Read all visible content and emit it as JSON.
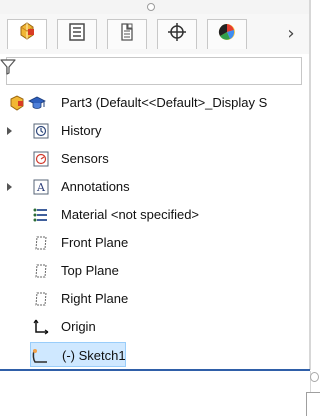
{
  "panel": {
    "tabs": [
      {
        "name": "featuremanager-tab",
        "icon": "featuremanager-icon"
      },
      {
        "name": "propertymanager-tab",
        "icon": "propertymanager-icon"
      },
      {
        "name": "configurationmanager-tab",
        "icon": "configurationmanager-icon"
      },
      {
        "name": "dimxpertmanager-tab",
        "icon": "dimxpert-icon"
      },
      {
        "name": "displaymanager-tab",
        "icon": "displaymanager-icon"
      }
    ],
    "more_tabs_label": "›",
    "filter": {
      "placeholder": ""
    }
  },
  "tree": {
    "root_label": "Part3  (Default<<Default>_Display S",
    "items": [
      {
        "label": "History",
        "icon": "history-icon",
        "expandable": true
      },
      {
        "label": "Sensors",
        "icon": "sensors-icon",
        "expandable": false
      },
      {
        "label": "Annotations",
        "icon": "annotations-icon",
        "expandable": true
      },
      {
        "label": "Material <not specified>",
        "icon": "material-icon",
        "expandable": false
      },
      {
        "label": "Front Plane",
        "icon": "plane-icon",
        "expandable": false
      },
      {
        "label": "Top Plane",
        "icon": "plane-icon",
        "expandable": false
      },
      {
        "label": "Right Plane",
        "icon": "plane-icon",
        "expandable": false
      },
      {
        "label": "Origin",
        "icon": "origin-icon",
        "expandable": false
      },
      {
        "label": "(-) Sketch1",
        "icon": "sketch-icon",
        "expandable": false,
        "selected": true
      }
    ]
  },
  "colors": {
    "selection_fill": "#cfe8ff",
    "selection_border": "#99cdfa",
    "bottom_rule": "#2f5fa8"
  }
}
